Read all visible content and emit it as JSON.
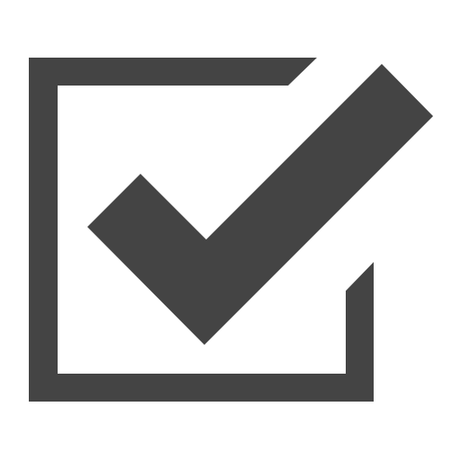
{
  "icon": {
    "name": "checked-checkbox-icon",
    "color": "#444444",
    "background": "#ffffff"
  }
}
